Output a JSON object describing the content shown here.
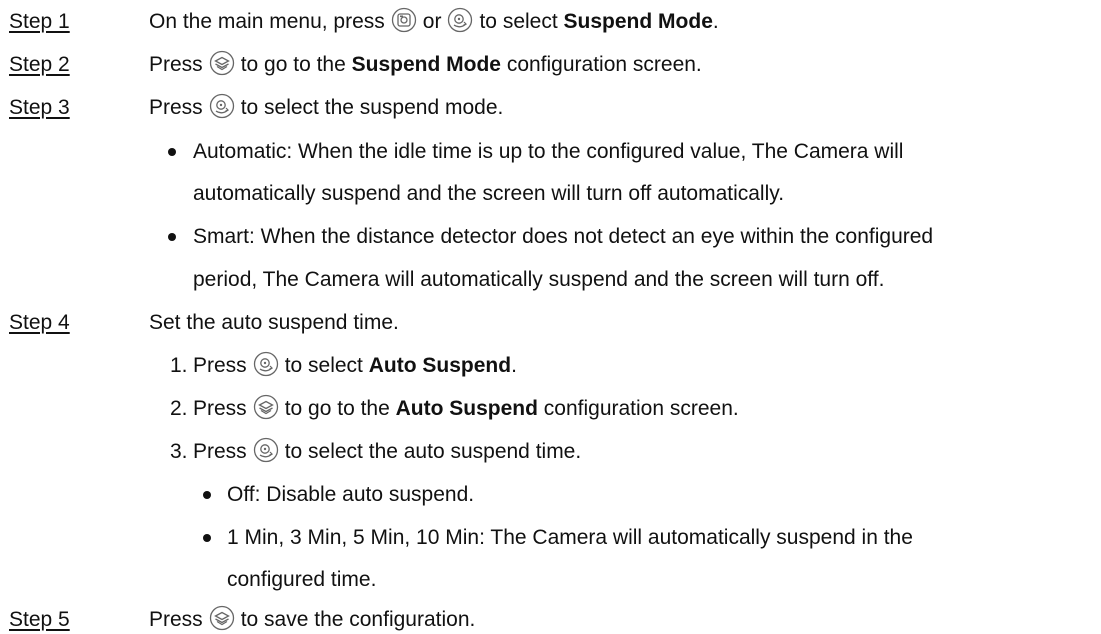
{
  "icons": {
    "menu_button": "menu-camera-icon",
    "dial_button": "dial-wheel-icon",
    "confirm_button": "layers-confirm-icon"
  },
  "steps": [
    {
      "label": "Step 1",
      "pre": "On the main menu, press",
      "mid": "or",
      "post": "to select",
      "bold": "Suspend Mode",
      "end": "."
    },
    {
      "label": "Step 2",
      "pre": "Press",
      "post": "to go to the",
      "bold": "Suspend Mode",
      "end": "configuration screen."
    },
    {
      "label": "Step 3",
      "pre": "Press",
      "post": "to select the suspend mode."
    },
    {
      "label": "Step 4",
      "text": "Set the auto suspend time."
    },
    {
      "label": "Step 5",
      "pre": "Press",
      "post": "to save the configuration."
    }
  ],
  "mode_bullets": [
    {
      "line1": "Automatic: When the idle time is up to the configured value, The Camera will",
      "line2": "automatically suspend and the screen will turn off automatically."
    },
    {
      "line1": "Smart: When the distance detector does not detect an eye within the configured",
      "line2": "period, The Camera will automatically suspend and the screen will turn off."
    }
  ],
  "substeps": [
    {
      "num": "1.",
      "pre": "Press",
      "post": "to select",
      "bold": "Auto Suspend",
      "end": "."
    },
    {
      "num": "2.",
      "pre": "Press",
      "post": "to go to the",
      "bold": "Auto Suspend",
      "end": "configuration screen."
    },
    {
      "num": "3.",
      "pre": "Press",
      "post": "to select the auto suspend time."
    }
  ],
  "time_bullets": [
    {
      "line1": "Off: Disable auto suspend."
    },
    {
      "line1": "1 Min, 3 Min, 5 Min, 10 Min: The Camera will automatically suspend in the",
      "line2": "configured time."
    }
  ]
}
